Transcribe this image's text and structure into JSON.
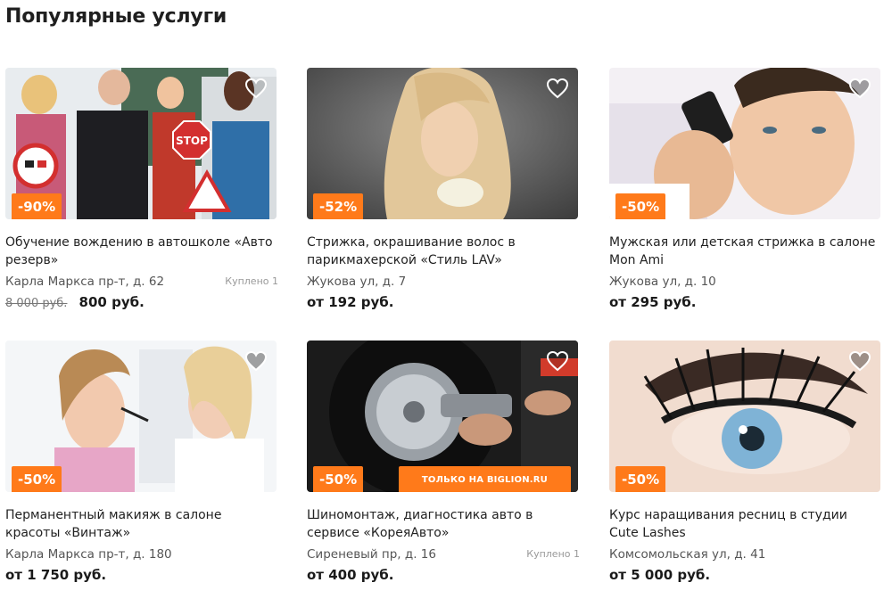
{
  "page": {
    "title": "Популярные услуги"
  },
  "colors": {
    "accent": "#ff7a1a",
    "text": "#222222",
    "muted": "#555555"
  },
  "cards": [
    {
      "discount": "-90%",
      "title": "Обучение вождению в автошколе «Авто резерв»",
      "address": "Карла Маркса пр-т, д. 62",
      "bought": "Куплено 1",
      "old_price": "8 000 руб.",
      "price": "800 руб.",
      "image_subject": "driving-school-people-photo",
      "image_text": "STOP"
    },
    {
      "discount": "-52%",
      "title": "Стрижка, окрашивание волос в парикмахерской «Стиль LAV»",
      "address": "Жукова ул, д. 7",
      "price": "от 192 руб.",
      "image_subject": "blonde-hair-woman-photo"
    },
    {
      "discount": "-50%",
      "title": "Мужская или детская стрижка в салоне Mon Ami",
      "address": "Жукова ул, д. 10",
      "price": "от 295 руб.",
      "image_subject": "man-haircut-photo"
    },
    {
      "discount": "-50%",
      "title": "Перманентный макияж в салоне красоты «Винтаж»",
      "address": "Карла Маркса пр-т, д. 180",
      "price": "от 1 750 руб.",
      "image_subject": "makeup-artist-photo"
    },
    {
      "discount": "-50%",
      "title": "Шиномонтаж, диагностика авто в сервисе «КореяАвто»",
      "address": "Сиреневый пр, д. 16",
      "bought": "Куплено 1",
      "price": "от 400 руб.",
      "promo": "ТОЛЬКО НА BIGLION.RU",
      "image_subject": "tire-service-photo"
    },
    {
      "discount": "-50%",
      "title": "Курс наращивания ресниц в студии Cute Lashes",
      "address": "Комсомольская ул, д. 41",
      "price": "от 5 000 руб.",
      "image_subject": "eyelash-closeup-photo"
    }
  ],
  "icons": {
    "favorite": "heart-icon"
  }
}
